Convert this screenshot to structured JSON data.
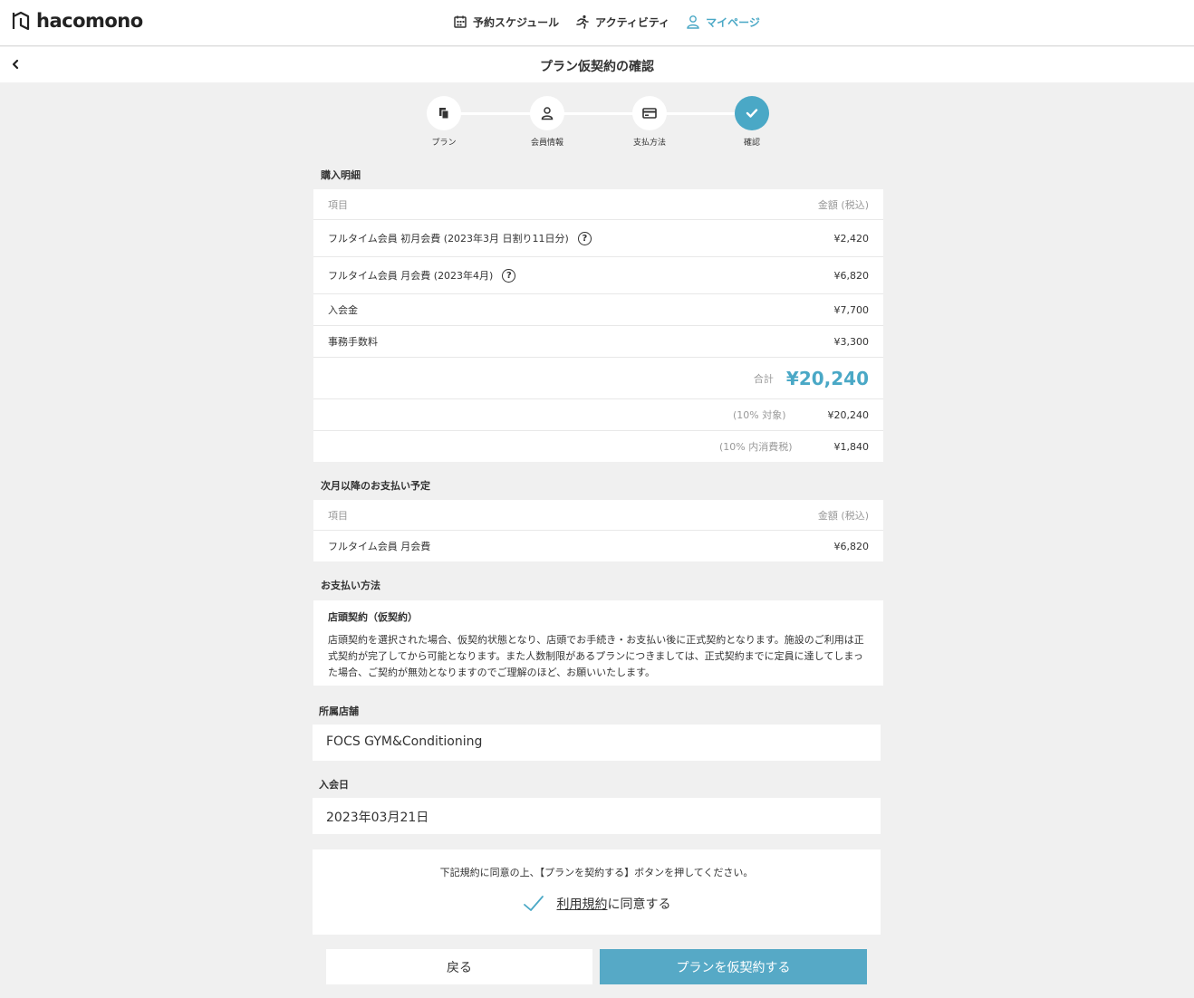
{
  "app": {
    "logo_text": "hacomono",
    "page_title": "プラン仮契約の確認"
  },
  "nav": [
    {
      "label": "予約スケジュール",
      "icon": "calendar-icon",
      "active": false
    },
    {
      "label": "アクティビティ",
      "icon": "run-icon",
      "active": false
    },
    {
      "label": "マイページ",
      "icon": "user-icon",
      "active": true
    }
  ],
  "steps": [
    {
      "label": "プラン",
      "icon": "document-icon",
      "done": false
    },
    {
      "label": "会員情報",
      "icon": "user-icon",
      "done": false
    },
    {
      "label": "支払方法",
      "icon": "card-icon",
      "done": false
    },
    {
      "label": "確認",
      "icon": "check-icon",
      "done": true
    }
  ],
  "purchase": {
    "title": "購入明細",
    "head_item": "項目",
    "head_amount": "金額 (税込)",
    "items": [
      {
        "label": "フルタイム会員 初月会費 (2023年3月 日割り11日分)",
        "amount": "¥2,420",
        "help": true
      },
      {
        "label": "フルタイム会員 月会費 (2023年4月)",
        "amount": "¥6,820",
        "help": true
      },
      {
        "label": "入会金",
        "amount": "¥7,700",
        "help": false
      },
      {
        "label": "事務手数料",
        "amount": "¥3,300",
        "help": false
      }
    ],
    "total_label": "合計",
    "total_amount": "¥20,240",
    "tax_rows": [
      {
        "label": "(10% 対象)",
        "amount": "¥20,240"
      },
      {
        "label": "(10% 内消費税)",
        "amount": "¥1,840"
      }
    ]
  },
  "next_payment": {
    "title": "次月以降のお支払い予定",
    "head_item": "項目",
    "head_amount": "金額 (税込)",
    "items": [
      {
        "label": "フルタイム会員 月会費",
        "amount": "¥6,820"
      }
    ]
  },
  "payment_method": {
    "title": "お支払い方法",
    "name": "店頭契約（仮契約）",
    "description": "店頭契約を選択された場合、仮契約状態となり、店頭でお手続き・お支払い後に正式契約となります。施設のご利用は正式契約が完了してから可能となります。また人数制限があるプランにつきましては、正式契約までに定員に達してしまった場合、ご契約が無効となりますのでご理解のほど、お願いいたします。"
  },
  "store": {
    "label": "所属店舗",
    "value": "FOCS GYM&Conditioning"
  },
  "join_date": {
    "label": "入会日",
    "value": "2023年03月21日"
  },
  "agreement": {
    "note": "下記規約に同意の上、【プランを契約する】ボタンを押してください。",
    "terms_link": "利用規約",
    "terms_suffix": "に同意する"
  },
  "buttons": {
    "back": "戻る",
    "submit": "プランを仮契約する"
  },
  "colors": {
    "accent": "#4aa8c6",
    "button": "#56a9c6"
  }
}
